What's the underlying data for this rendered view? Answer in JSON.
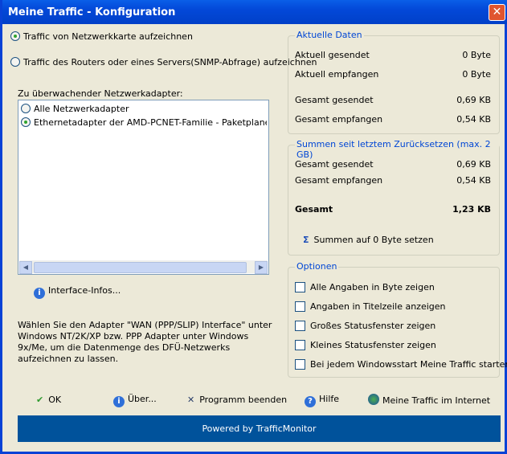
{
  "window": {
    "title": "Meine Traffic - Konfiguration"
  },
  "mode": {
    "options": [
      {
        "label": "Traffic von Netzwerkkarte aufzeichnen",
        "selected": true
      },
      {
        "label": "Traffic des Routers oder eines Servers(SNMP-Abfrage) aufzeichnen",
        "selected": false
      }
    ]
  },
  "adapter": {
    "label": "Zu überwachender Netzwerkadapter:",
    "items": [
      {
        "label": "Alle Netzwerkadapter",
        "selected": false
      },
      {
        "label": "Ethernetadapter der AMD-PCNET-Familie - Paketplaner-Miniport",
        "selected": true
      }
    ],
    "interface_info": "Interface-Infos...",
    "hint": "Wählen Sie den Adapter \"WAN (PPP/SLIP) Interface\" unter Windows NT/2K/XP bzw. PPP Adapter unter Windows 9x/Me, um die Datenmenge des DFÜ-Netzwerks aufzeichnen zu lassen."
  },
  "current": {
    "legend": "Aktuelle Daten",
    "rows": [
      {
        "label": "Aktuell gesendet",
        "value": "0 Byte"
      },
      {
        "label": "Aktuell empfangen",
        "value": "0 Byte"
      },
      {
        "label": "Gesamt gesendet",
        "value": "0,69 KB"
      },
      {
        "label": "Gesamt empfangen",
        "value": "0,54 KB"
      }
    ]
  },
  "sums": {
    "legend": "Summen seit letztem Zurücksetzen (max. 2 GB)",
    "rows": [
      {
        "label": "Gesamt gesendet",
        "value": "0,69 KB"
      },
      {
        "label": "Gesamt empfangen",
        "value": "0,54 KB"
      }
    ],
    "total_label": "Gesamt",
    "total_value": "1,23 KB",
    "reset": "Summen auf 0 Byte setzen"
  },
  "options": {
    "legend": "Optionen",
    "items": [
      {
        "label": "Alle Angaben in Byte zeigen",
        "checked": false
      },
      {
        "label": "Angaben in Titelzeile anzeigen",
        "checked": false
      },
      {
        "label": "Großes Statusfenster zeigen",
        "checked": false
      },
      {
        "label": "Kleines Statusfenster zeigen",
        "checked": false
      },
      {
        "label": "Bei jedem Windowsstart Meine Traffic starten",
        "checked": false
      }
    ]
  },
  "buttons": {
    "ok": "OK",
    "about": "Über...",
    "exit": "Programm beenden",
    "help": "Hilfe",
    "web": "Meine Traffic im Internet"
  },
  "footer": "Powered by TrafficMonitor"
}
